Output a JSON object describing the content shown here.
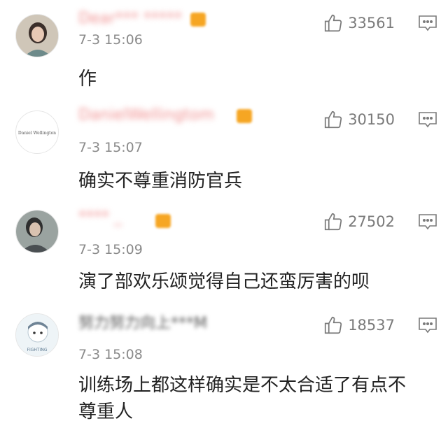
{
  "colors": {
    "text": "#222222",
    "meta": "#8a8a8a",
    "icon": "#7a7a7a",
    "badge": "#f6a623"
  },
  "comments": [
    {
      "name": "Dear*** *****",
      "time": "7-3 15:06",
      "likes": "33561",
      "text": "作"
    },
    {
      "name": "DanielWellingtom",
      "time": "7-3 15:07",
      "likes": "30150",
      "text": "确实不尊重消防官兵",
      "avatar_text": "Daniel Wellington"
    },
    {
      "name": "**** _",
      "time": "7-3 15:09",
      "likes": "27502",
      "text": "演了部欢乐颂觉得自己还蛮厉害的呗"
    },
    {
      "name": "努力努力向上***M",
      "time": "7-3 15:08",
      "likes": "18537",
      "text": "训练场上都这样确实是不太合适了有点不尊重人",
      "avatar_text": "FIGHTING"
    }
  ]
}
